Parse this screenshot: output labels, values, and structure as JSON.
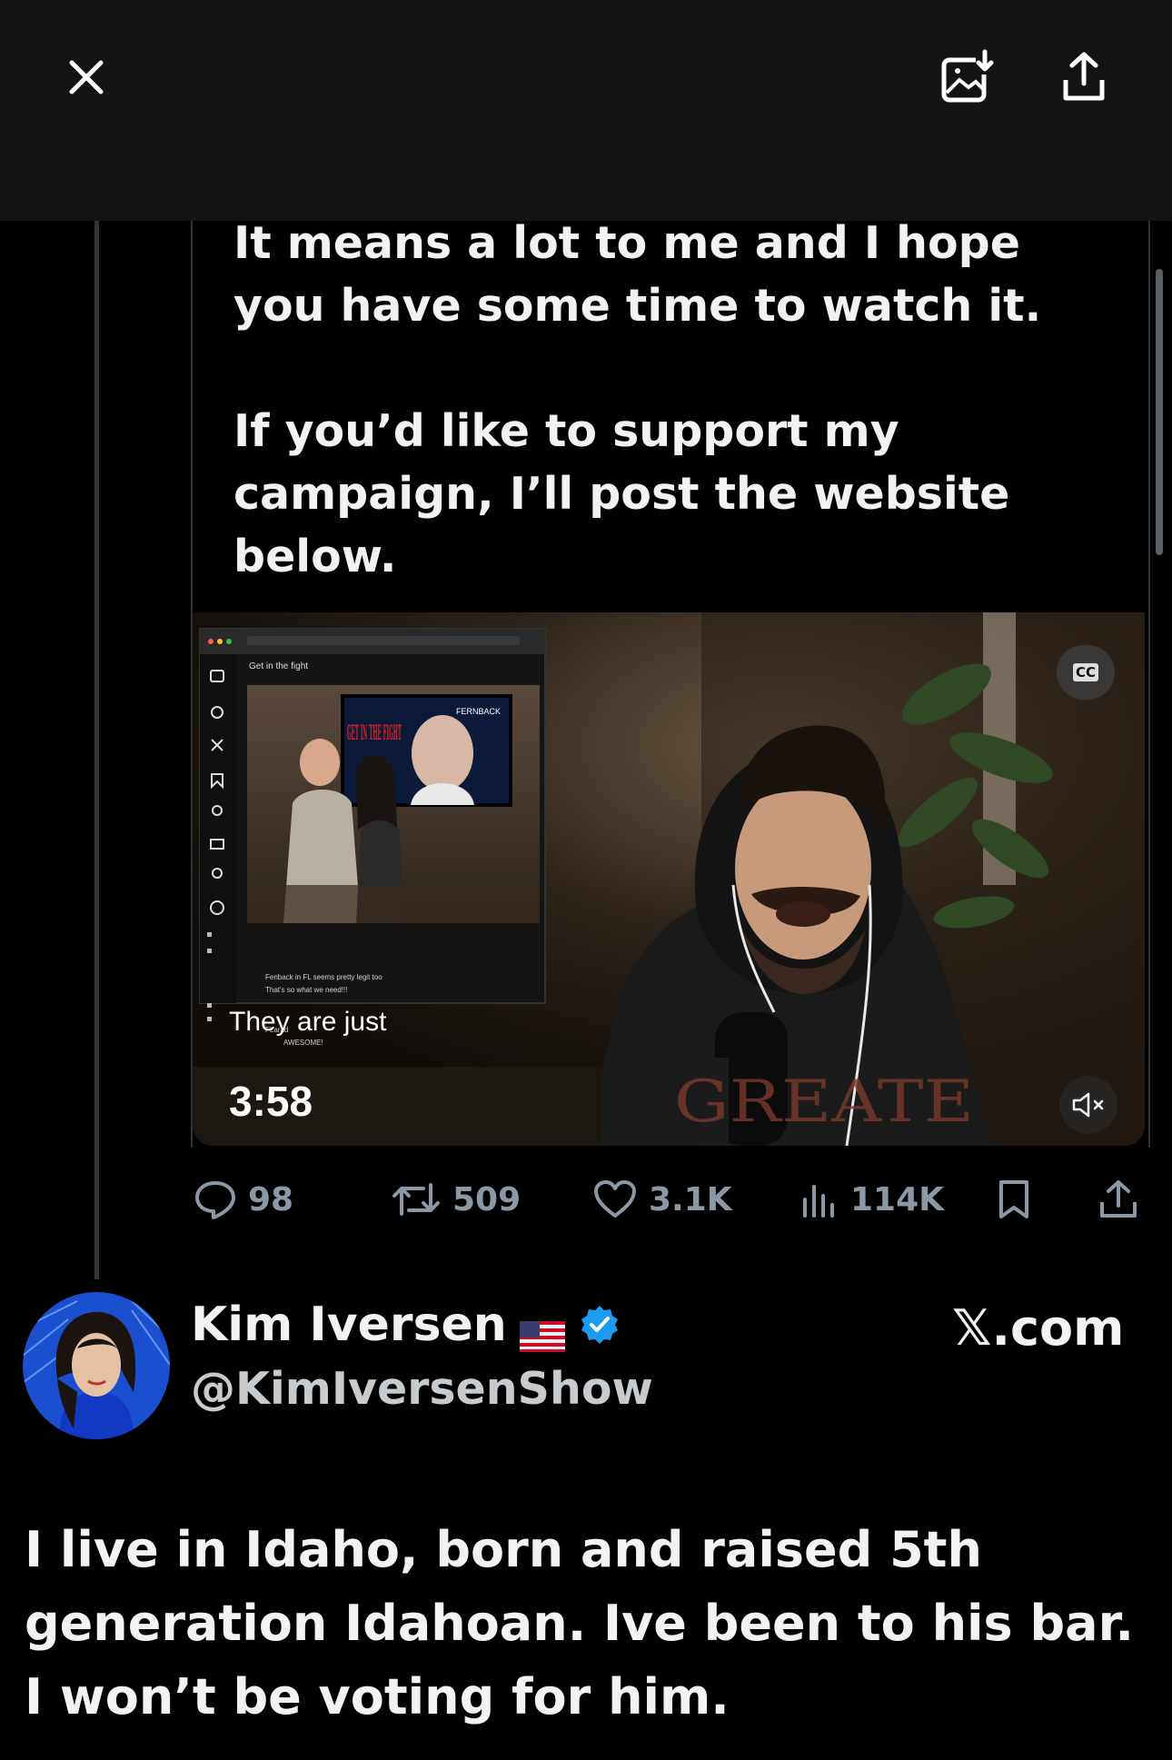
{
  "viewer": {
    "close_icon": "close-icon",
    "save_icon": "save-image-icon",
    "share_icon": "share-icon"
  },
  "tweet": {
    "paragraphs": [
      "It means a lot to me and I hope you have some time to watch it.",
      "If you’d like to support my campaign, I’ll post the website below."
    ],
    "video": {
      "caption": "They are just",
      "time": "3:58",
      "cc_label": "CC",
      "inset_page_title": "Get in the fight",
      "tv_text": "GET IN THE FIGHT",
      "banner_text": "FERNBACK",
      "hoodie_text": "GREATE",
      "chat_lines": [
        "Fenback in FL seems pretty legit too",
        "That's so what we need!!!",
        "FLarad",
        "AWESOME!"
      ]
    },
    "stats": {
      "replies": "98",
      "reposts": "509",
      "likes": "3.1K",
      "views": "114K"
    }
  },
  "reply": {
    "name": "Kim Iversen",
    "flag": "🇺🇸",
    "handle": "@KimIversenShow",
    "source": "𝕏.com",
    "text": "I live in Idaho, born and raised 5th generation Idahoan. Ive been to his bar. I won’t be voting for him."
  },
  "colors": {
    "background": "#000000",
    "topbar": "#141414",
    "text": "#f2f2f2",
    "muted": "#8b98a5",
    "verified": "#1d9bf0"
  }
}
